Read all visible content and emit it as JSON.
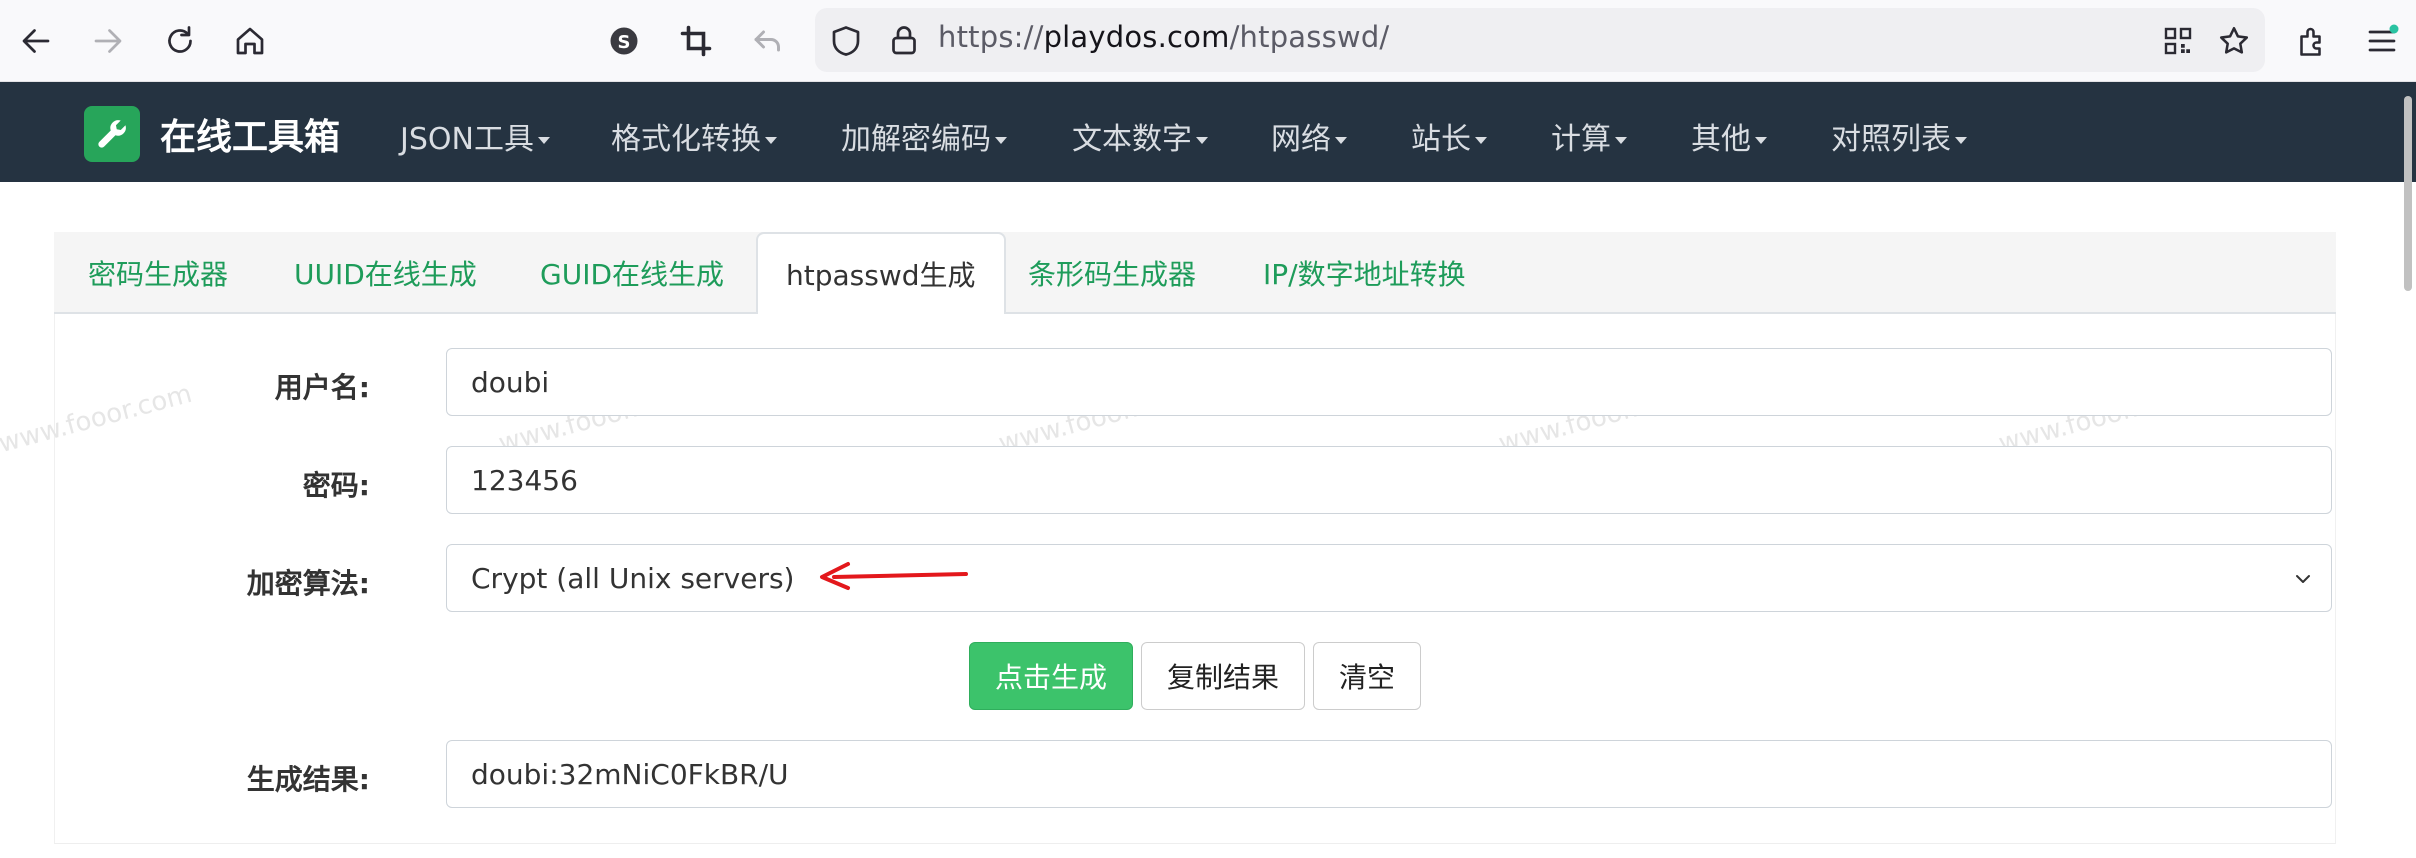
{
  "browser": {
    "url_scheme": "https://",
    "url_host": "playdos.com",
    "url_path": "/htpasswd/",
    "icons": [
      "back-arrow-icon",
      "forward-arrow-icon",
      "reload-icon",
      "home-icon",
      "s-extension-icon",
      "crop-icon",
      "undo-icon",
      "shield-icon",
      "lock-icon",
      "qr-code-icon",
      "star-icon",
      "extensions-icon",
      "menu-icon"
    ]
  },
  "nav": {
    "brand": "在线工具箱",
    "items": [
      "JSON工具",
      "格式化转换",
      "加解密编码",
      "文本数字",
      "网络",
      "站长",
      "计算",
      "其他",
      "对照列表"
    ]
  },
  "tabs": [
    "密码生成器",
    "UUID在线生成",
    "GUID在线生成",
    "htpasswd生成",
    "条形码生成器",
    "IP/数字地址转换"
  ],
  "active_tab": "htpasswd生成",
  "form": {
    "username_label": "用户名:",
    "username_value": "doubi",
    "password_label": "密码:",
    "password_value": "123456",
    "algorithm_label": "加密算法:",
    "algorithm_value": "Crypt (all Unix servers)",
    "generate_button": "点击生成",
    "copy_button": "复制结果",
    "clear_button": "清空",
    "result_label": "生成结果:",
    "result_value": "doubi:32mNiC0FkBR/U"
  },
  "watermark": "www.fooor.com",
  "colors": {
    "navbar": "#253341",
    "brand_green": "#27a55a",
    "tab_text": "#1e9c5a",
    "primary_button": "#3cc36b",
    "annotation_arrow": "#e3181c"
  }
}
